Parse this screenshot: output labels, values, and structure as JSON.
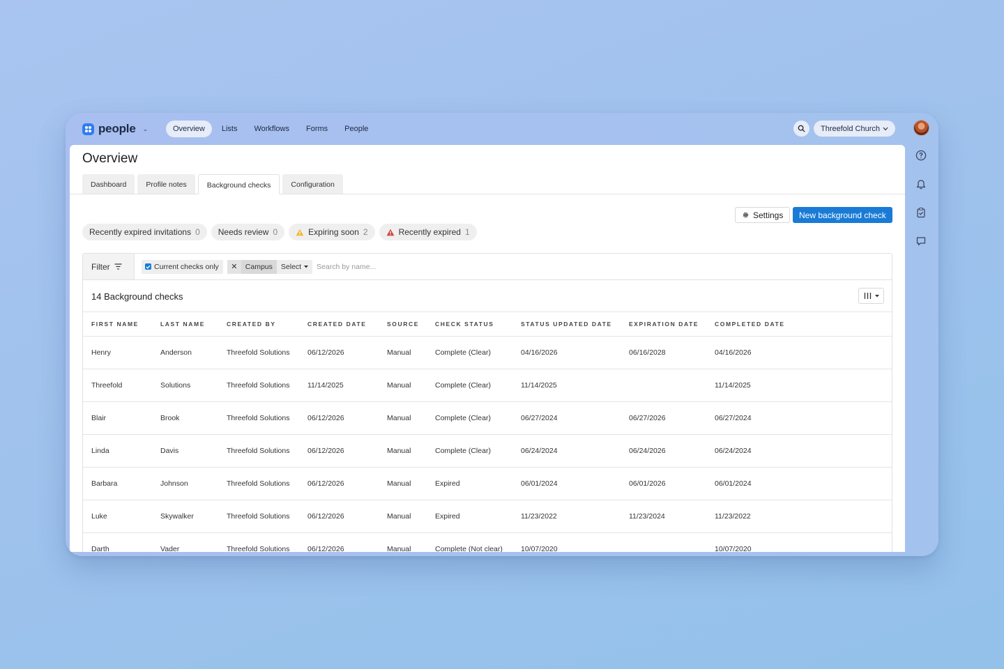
{
  "app": {
    "name": "people",
    "org": "Threefold Church"
  },
  "nav": [
    {
      "label": "Overview",
      "active": true
    },
    {
      "label": "Lists"
    },
    {
      "label": "Workflows"
    },
    {
      "label": "Forms"
    },
    {
      "label": "People"
    }
  ],
  "page": {
    "title": "Overview"
  },
  "tabs": [
    {
      "label": "Dashboard"
    },
    {
      "label": "Profile notes"
    },
    {
      "label": "Background checks",
      "active": true
    },
    {
      "label": "Configuration"
    }
  ],
  "actions": {
    "settings": "Settings",
    "new_check": "New background check"
  },
  "pills": [
    {
      "label": "Recently expired invitations",
      "count": "0"
    },
    {
      "label": "Needs review",
      "count": "0"
    },
    {
      "label": "Expiring soon",
      "count": "2",
      "icon": "warning-icon",
      "color": "#f2b630"
    },
    {
      "label": "Recently expired",
      "count": "1",
      "icon": "alert-icon",
      "color": "#d0453a"
    }
  ],
  "filter": {
    "label": "Filter",
    "current_only": "Current checks only",
    "campus": "Campus",
    "select": "Select",
    "search_placeholder": "Search by name..."
  },
  "table": {
    "count_label": "14 Background checks",
    "columns": [
      "FIRST NAME",
      "LAST NAME",
      "CREATED BY",
      "CREATED DATE",
      "SOURCE",
      "CHECK STATUS",
      "STATUS UPDATED DATE",
      "EXPIRATION DATE",
      "COMPLETED DATE"
    ],
    "rows": [
      [
        "Henry",
        "Anderson",
        "Threefold Solutions",
        "06/12/2026",
        "Manual",
        "Complete (Clear)",
        "04/16/2026",
        "06/16/2028",
        "04/16/2026"
      ],
      [
        "Threefold",
        "Solutions",
        "Threefold Solutions",
        "11/14/2025",
        "Manual",
        "Complete (Clear)",
        "11/14/2025",
        "",
        "11/14/2025"
      ],
      [
        "Blair",
        "Brook",
        "Threefold Solutions",
        "06/12/2026",
        "Manual",
        "Complete (Clear)",
        "06/27/2024",
        "06/27/2026",
        "06/27/2024"
      ],
      [
        "Linda",
        "Davis",
        "Threefold Solutions",
        "06/12/2026",
        "Manual",
        "Complete (Clear)",
        "06/24/2024",
        "06/24/2026",
        "06/24/2024"
      ],
      [
        "Barbara",
        "Johnson",
        "Threefold Solutions",
        "06/12/2026",
        "Manual",
        "Expired",
        "06/01/2024",
        "06/01/2026",
        "06/01/2024"
      ],
      [
        "Luke",
        "Skywalker",
        "Threefold Solutions",
        "06/12/2026",
        "Manual",
        "Expired",
        "11/23/2022",
        "11/23/2024",
        "11/23/2022"
      ],
      [
        "Darth",
        "Vader",
        "Threefold Solutions",
        "06/12/2026",
        "Manual",
        "Complete (Not clear)",
        "10/07/2020",
        "",
        "10/07/2020"
      ]
    ]
  },
  "colors": {
    "accent": "#1a7bd6",
    "brand": "#2f7cf0"
  }
}
